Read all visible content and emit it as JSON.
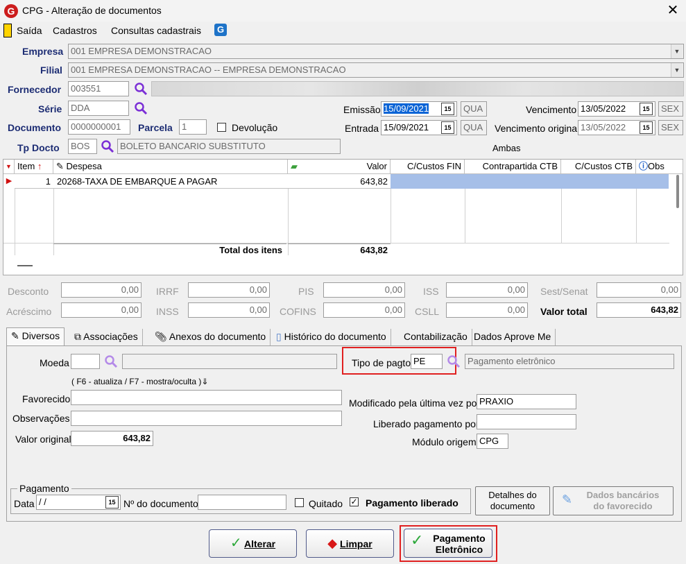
{
  "window": {
    "title": "CPG - Alteração de documentos",
    "close_glyph": "✕",
    "logo": "G"
  },
  "menu": {
    "items": [
      "Saída",
      "Cadastros",
      "Consultas cadastrais"
    ]
  },
  "form": {
    "empresa_label": "Empresa",
    "empresa_value": "001 EMPRESA DEMONSTRACAO",
    "filial_label": "Filial",
    "filial_value": "001 EMPRESA DEMONSTRACAO -- EMPRESA DEMONSTRACAO",
    "fornecedor_label": "Fornecedor",
    "fornecedor_value": "003551",
    "serie_label": "Série",
    "serie_value": "DDA",
    "documento_label": "Documento",
    "documento_value": "0000000001",
    "parcela_label": "Parcela",
    "parcela_value": "1",
    "devolucao_label": "Devolução",
    "tpdocto_label": "Tp Docto",
    "tpdocto_value": "BOS",
    "tpdocto_desc": "BOLETO BANCARIO SUBSTITUTO",
    "emissao_label": "Emissão",
    "emissao_value": "15/09/2021",
    "emissao_day": "QUA",
    "entrada_label": "Entrada",
    "entrada_value": "15/09/2021",
    "entrada_day": "QUA",
    "vencimento_label": "Vencimento",
    "vencimento_value": "13/05/2022",
    "vencimento_day": "SEX",
    "venc_original_label": "Vencimento original",
    "venc_original_value": "13/05/2022",
    "venc_original_day": "SEX",
    "ambas": "Ambas",
    "cal_glyph": "15"
  },
  "grid": {
    "columns": [
      "Item",
      "Despesa",
      "Valor",
      "C/Custos FIN",
      "Contrapartida CTB",
      "C/Custos CTB",
      "Obs"
    ],
    "rows": [
      {
        "item": "1",
        "despesa": "20268-TAXA DE EMBARQUE A PAGAR",
        "valor": "643,82"
      }
    ],
    "total_label": "Total dos itens",
    "total_value": "643,82"
  },
  "totals": {
    "desconto_label": "Desconto",
    "desconto": "0,00",
    "irrf_label": "IRRF",
    "irrf": "0,00",
    "pis_label": "PIS",
    "pis": "0,00",
    "iss_label": "ISS",
    "iss": "0,00",
    "sest_label": "Sest/Senat",
    "sest": "0,00",
    "acrescimo_label": "Acréscimo",
    "acrescimo": "0,00",
    "inss_label": "INSS",
    "inss": "0,00",
    "cofins_label": "COFINS",
    "cofins": "0,00",
    "csll_label": "CSLL",
    "csll": "0,00",
    "valor_total_label": "Valor total",
    "valor_total": "643,82"
  },
  "tabs": [
    "Diversos",
    "Associações",
    "Anexos do documento",
    "Histórico do documento",
    "Contabilização",
    "Dados Aprove Me"
  ],
  "diversos": {
    "moeda_label": "Moeda",
    "moeda_value": "",
    "hint": "( F6 - atualiza / F7 - mostra/oculta )",
    "tipo_pagto_label": "Tipo de pagto",
    "tipo_pagto_value": "PE",
    "tipo_pagto_desc": "Pagamento eletrônico",
    "favorecido_label": "Favorecido",
    "observacoes_label": "Observações",
    "valor_original_label": "Valor original",
    "valor_original": "643,82",
    "modificado_label": "Modificado pela última vez por",
    "modificado_value": "PRAXIO",
    "liberado_label": "Liberado pagamento por",
    "liberado_value": "",
    "modulo_label": "Módulo origem",
    "modulo_value": "CPG"
  },
  "pagamento": {
    "legend": "Pagamento",
    "data_label": "Data",
    "data_value": " /  /",
    "ndoc_label": "Nº do documento",
    "ndoc_value": "",
    "quitado_label": "Quitado",
    "liberado_label": "Pagamento liberado",
    "detalhes_line1": "Detalhes do",
    "detalhes_line2": "documento",
    "dados_line1": "Dados bancários",
    "dados_line2": "do favorecido"
  },
  "actions": {
    "alterar": "Alterar",
    "limpar": "Limpar",
    "pagamento_line1": "Pagamento",
    "pagamento_line2": "Eletrônico"
  },
  "colors": {
    "accent_red": "#e02020",
    "label_blue": "#1c2c73",
    "magnifier": "#7b2fd6",
    "selection": "#a6bfe8"
  },
  "icons": [
    "exit-icon",
    "g-logo-icon",
    "magnifier-icon",
    "calendar-icon",
    "check-icon",
    "eraser-icon",
    "pencil-icon",
    "info-icon"
  ]
}
